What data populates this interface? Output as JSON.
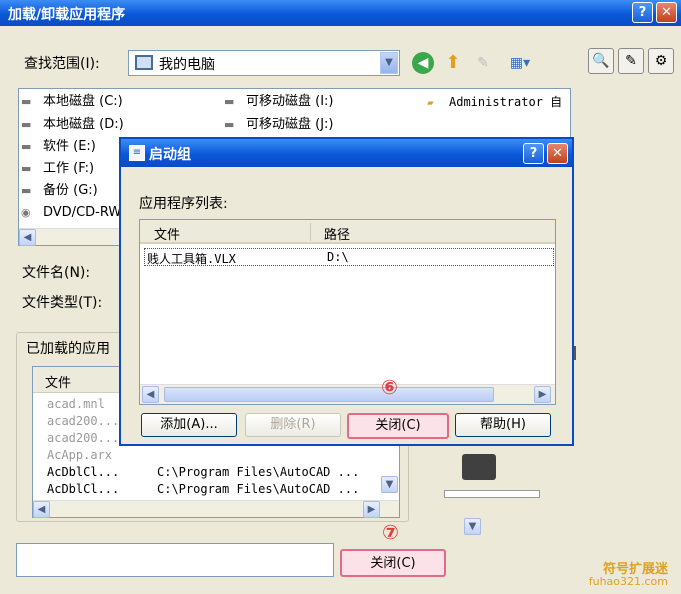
{
  "outer": {
    "title": "加载/卸载应用程序",
    "help_btn": "?",
    "close_btn": "✕",
    "look_in_label": "查找范围(I):",
    "look_in_value": "我的电脑",
    "drives": [
      {
        "icon": "hard-drive-icon",
        "label": "本地磁盘 (C:)"
      },
      {
        "icon": "hard-drive-icon",
        "label": "本地磁盘 (D:)"
      },
      {
        "icon": "hard-drive-icon",
        "label": "软件 (E:)"
      },
      {
        "icon": "hard-drive-icon",
        "label": "工作 (F:)"
      },
      {
        "icon": "hard-drive-icon",
        "label": "备份 (G:)"
      },
      {
        "icon": "cd-drive-icon",
        "label": "DVD/CD-RW"
      },
      {
        "icon": "removable-drive-icon",
        "label": "可移动磁盘 (I:)"
      },
      {
        "icon": "removable-drive-icon",
        "label": "可移动磁盘 (J:)"
      },
      {
        "icon": "folder-icon",
        "label": "Administrator 自"
      }
    ],
    "filename_label": "文件名(N):",
    "filetype_label": "文件类型(T):",
    "loaded_group_label": "已加载的应用",
    "loaded_file_header": "文件",
    "loaded_rows": [
      {
        "file": "acad.mnl",
        "path": "",
        "dim": true
      },
      {
        "file": "acad200...",
        "path": "",
        "dim": true
      },
      {
        "file": "acad200...",
        "path": "",
        "dim": true
      },
      {
        "file": "AcApp.arx",
        "path": "",
        "dim": true
      },
      {
        "file": "AcDblCl...",
        "path": "C:\\Program Files\\AutoCAD ...",
        "dim": false
      },
      {
        "file": "AcDblCl...",
        "path": "C:\\Program Files\\AutoCAD ...",
        "dim": false
      }
    ],
    "close_button": "关闭(C)",
    "step_marker": "⑦"
  },
  "inner": {
    "title": "启动组",
    "help_btn": "?",
    "close_btn": "✕",
    "list_label": "应用程序列表:",
    "col_file": "文件",
    "col_path": "路径",
    "rows": [
      {
        "file": "贱人工具箱.VLX",
        "path": "D:\\"
      }
    ],
    "add_button": "添加(A)...",
    "remove_button": "删除(R)",
    "close_button": "关闭(C)",
    "help_button": "帮助(H)",
    "step_marker": "⑥"
  },
  "watermark": {
    "title": "符号扩展迷",
    "url": "fuhao321.com"
  }
}
